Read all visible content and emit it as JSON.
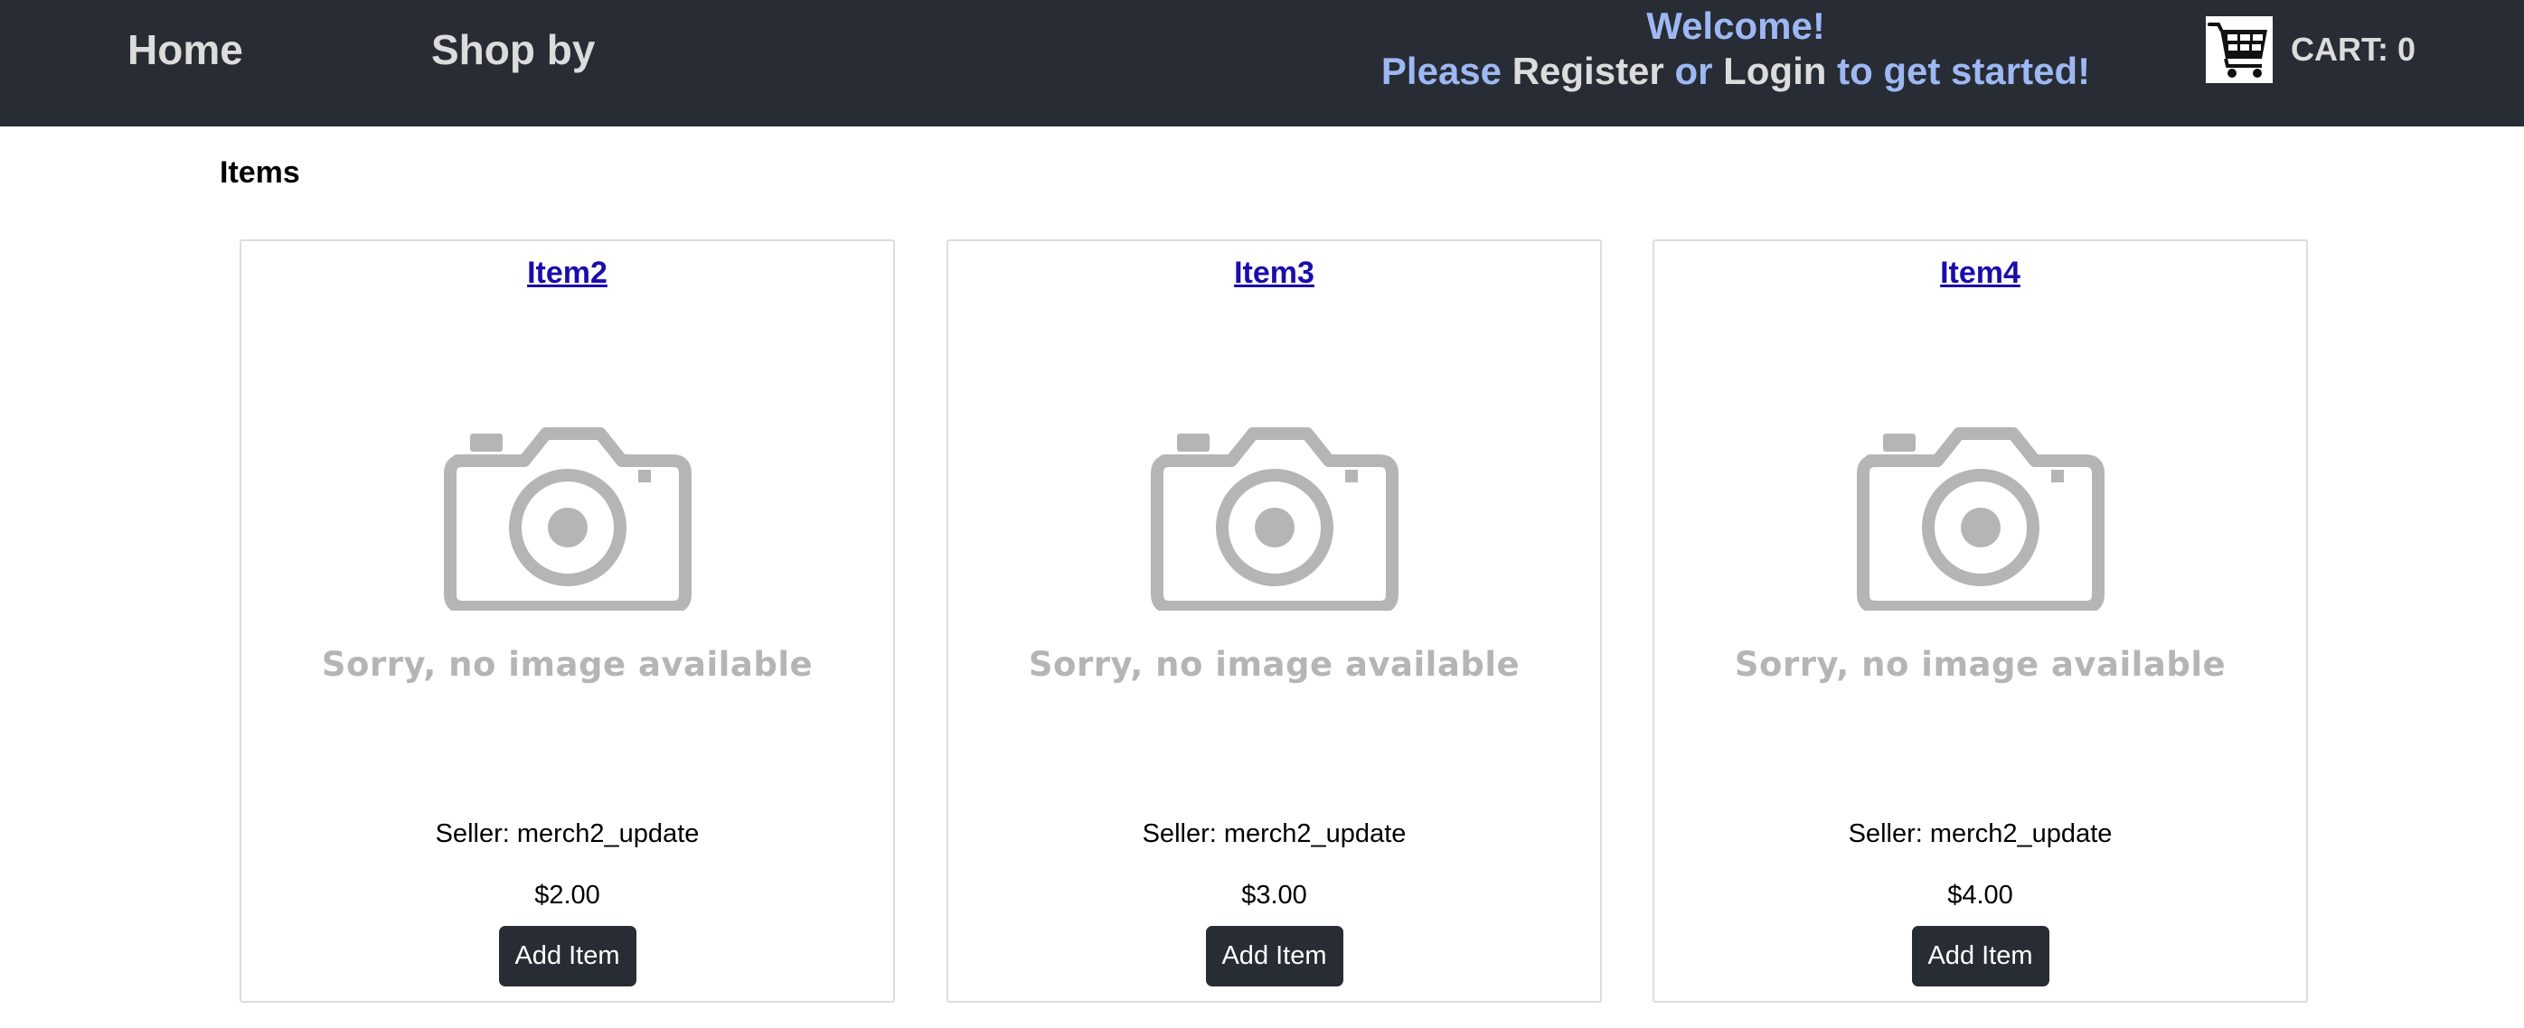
{
  "nav": {
    "home_label": "Home",
    "shop_label": "Shop by"
  },
  "welcome": {
    "title": "Welcome!",
    "please": "Please",
    "register_label": "Register",
    "or": "or",
    "login_label": "Login",
    "suffix": "to get started!"
  },
  "cart": {
    "icon": "shopping-cart-icon",
    "label": "CART: 0"
  },
  "main": {
    "title": "Items",
    "placeholder_text": "Sorry, no image available",
    "add_label": "Add Item",
    "items": [
      {
        "name": "Item2",
        "seller": "Seller: merch2_update",
        "price": "$2.00"
      },
      {
        "name": "Item3",
        "seller": "Seller: merch2_update",
        "price": "$3.00"
      },
      {
        "name": "Item4",
        "seller": "Seller: merch2_update",
        "price": "$4.00"
      }
    ]
  },
  "colors": {
    "navbar_bg": "#282c34",
    "welcome_blue": "#9db8f3",
    "link_blue": "#1a0dab",
    "placeholder_gray": "#b5b5b5"
  }
}
